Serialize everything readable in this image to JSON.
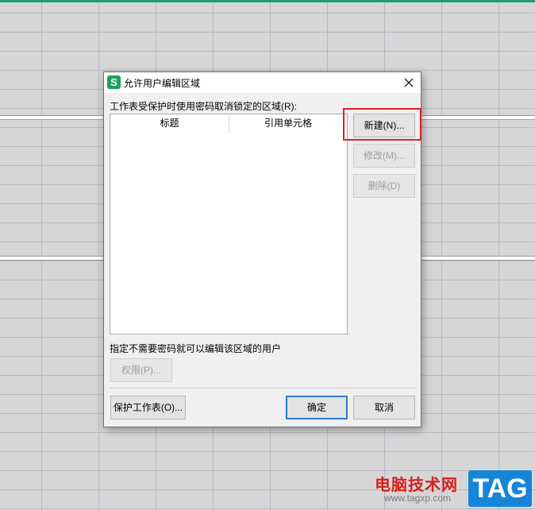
{
  "dialog": {
    "title": "允许用户编辑区域",
    "app_icon_letter": "S",
    "areas_label": "工作表受保护时使用密码取消锁定的区域(R):",
    "columns": [
      "标题",
      "引用单元格"
    ],
    "buttons": {
      "new": "新建(N)...",
      "modify": "修改(M)...",
      "delete": "删除(D)",
      "permissions": "权限(P)...",
      "protect_sheet": "保护工作表(O)...",
      "ok": "确定",
      "cancel": "取消"
    },
    "users_label": "指定不需要密码就可以编辑该区域的用户"
  },
  "watermark": {
    "text": "电脑技术网",
    "url": "www.tagxp.com",
    "badge": "TAG"
  },
  "icons": [
    "app-icon",
    "close-icon"
  ],
  "colors": {
    "highlight": "#e02020",
    "primary_border": "#2f7ad8",
    "app_icon": "#1ba35d",
    "watermark_badge": "#1585d8"
  }
}
